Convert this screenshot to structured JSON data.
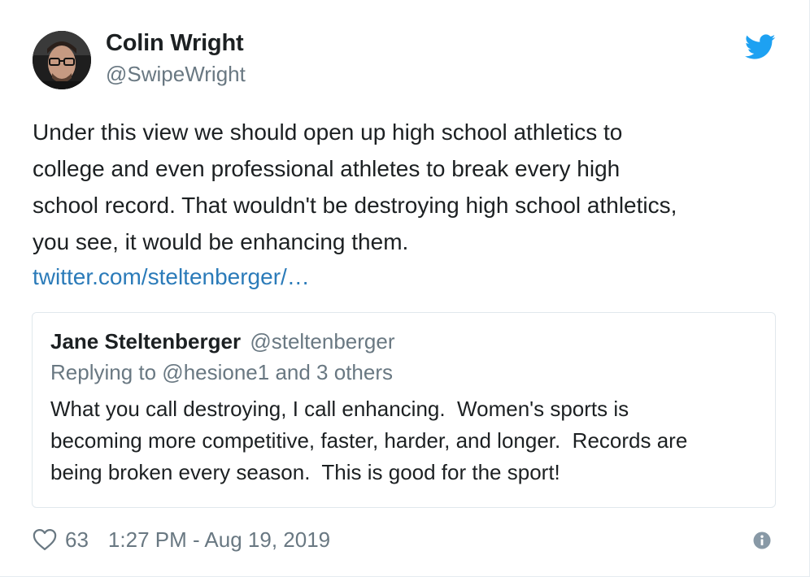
{
  "author": {
    "name": "Colin Wright",
    "handle": "@SwipeWright"
  },
  "tweet": {
    "lines": [
      "Under this view we should open up high school athletics to",
      "college and even professional athletes to break every high",
      "school record. That wouldn't be destroying high school athletics,",
      "you see, it would be enhancing them."
    ],
    "link": "twitter.com/steltenberger/…"
  },
  "quoted_tweet": {
    "name": "Jane Steltenberger",
    "handle": "@steltenberger",
    "reply_context": "Replying to @hesione1 and 3 others",
    "lines": [
      "What you call destroying, I call enhancing.  Women's sports is",
      "becoming more competitive, faster, harder, and longer.  Records are",
      "being broken every season.  This is good for the sport!"
    ]
  },
  "footer": {
    "like_count": "63",
    "timestamp": "1:27 PM - Aug 19, 2019"
  },
  "icons": {
    "brand": "twitter-bird-icon",
    "like": "heart-icon",
    "info": "info-icon"
  },
  "colors": {
    "twitter_blue": "#1da1f2",
    "link": "#2b7bb9",
    "secondary_text": "#697882",
    "primary_text": "#1c2022",
    "border": "#e1e8ed"
  }
}
